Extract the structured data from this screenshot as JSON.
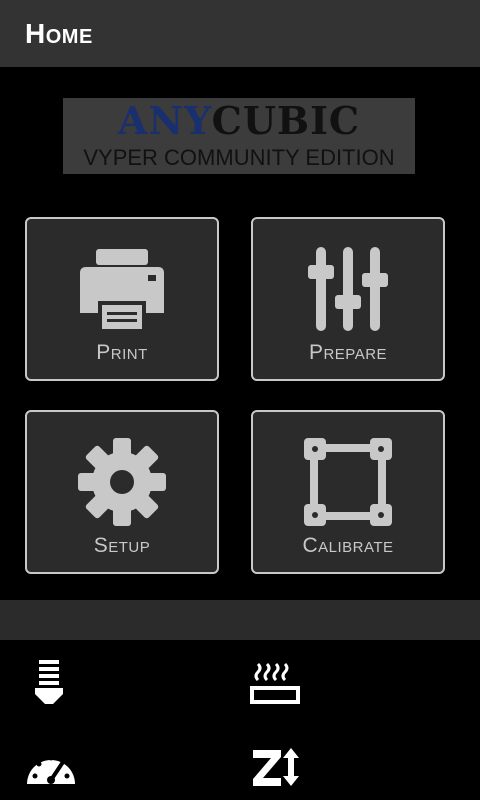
{
  "header": {
    "title": "Home"
  },
  "logo": {
    "brand_part1": "ANY",
    "brand_part2": "CUBIC",
    "subtitle": "VYPER COMMUNITY EDITION"
  },
  "menu": {
    "print_label": "Print",
    "prepare_label": "Prepare",
    "setup_label": "Setup",
    "calibrate_label": "Calibrate"
  },
  "status": {
    "icons": [
      "nozzle-icon",
      "heated-bed-icon",
      "speed-gauge-icon",
      "z-axis-icon"
    ]
  },
  "colors": {
    "header_bg": "#333333",
    "tile_bg": "#2b2b2b",
    "tile_border": "#c8c8c8",
    "icon": "#c8c8c8"
  }
}
